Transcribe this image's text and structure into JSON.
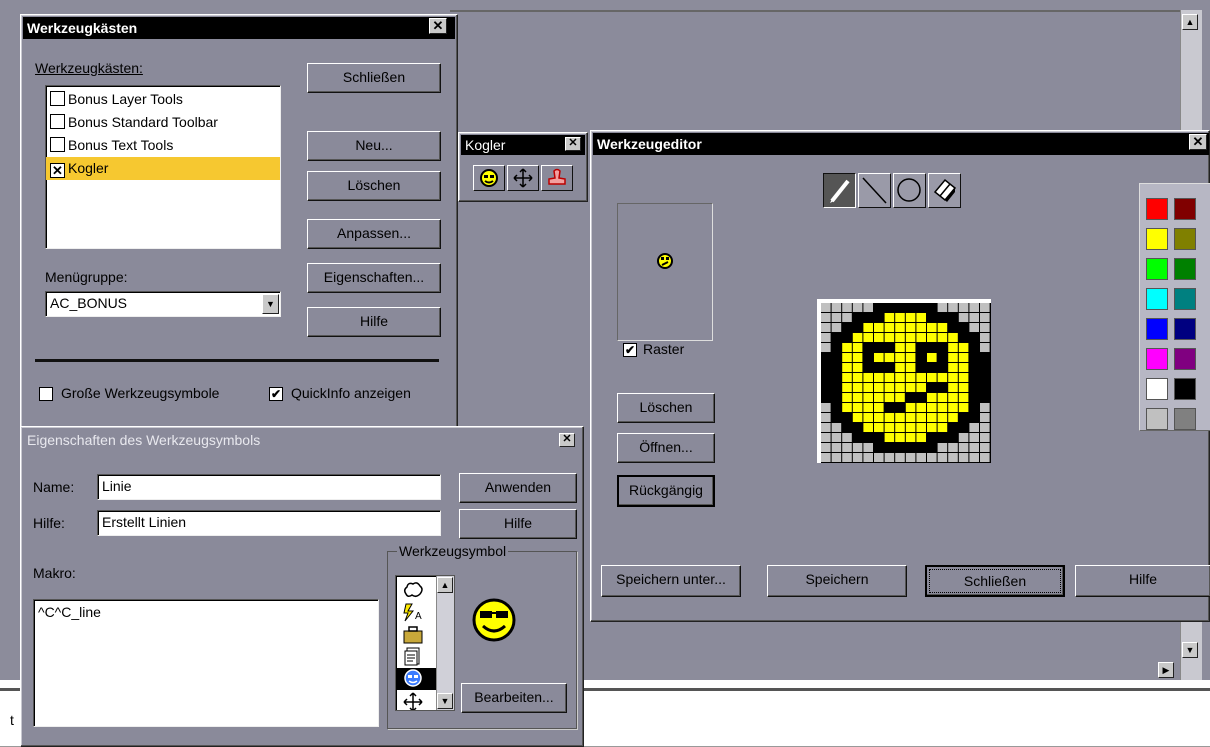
{
  "toolbars_dialog": {
    "title": "Werkzeugkästen",
    "list_label": "Werkzeugkästen:",
    "items": [
      {
        "label": "Bonus Layer Tools",
        "check": ""
      },
      {
        "label": "Bonus Standard Toolbar",
        "check": ""
      },
      {
        "label": "Bonus Text Tools",
        "check": ""
      },
      {
        "label": "Kogler",
        "check": "✕"
      }
    ],
    "buttons": {
      "close": "Schließen",
      "new": "Neu...",
      "delete": "Löschen",
      "customize": "Anpassen...",
      "properties": "Eigenschaften...",
      "help": "Hilfe"
    },
    "menu_group_label": "Menügruppe:",
    "menu_group_value": "AC_BONUS",
    "large_icons_label": "Große Werkzeugsymbole",
    "large_icons_check": "",
    "tooltips_label": "QuickInfo anzeigen",
    "tooltips_check": "✔"
  },
  "kogler_toolbar": {
    "title": "Kogler",
    "close": "✕"
  },
  "props_dialog": {
    "title": "Eigenschaften des Werkzeugsymbols",
    "name_label": "Name:",
    "name_value": "Linie",
    "help_label": "Hilfe:",
    "help_value": "Erstellt Linien",
    "macro_label": "Makro:",
    "macro_value": "^C^C_line",
    "group_label": "Werkzeugsymbol",
    "apply": "Anwenden",
    "help_button": "Hilfe",
    "edit_button": "Bearbeiten..."
  },
  "editor": {
    "title": "Werkzeugeditor",
    "raster_label": "Raster",
    "raster_check": "✔",
    "clear": "Löschen",
    "open": "Öffnen...",
    "undo": "Rückgängig",
    "save_as": "Speichern unter...",
    "save": "Speichern",
    "close": "Schließen",
    "help": "Hilfe",
    "palette": [
      "#ff0000",
      "#800000",
      "#ffff00",
      "#808000",
      "#00ff00",
      "#008000",
      "#00ffff",
      "#008080",
      "#0000ff",
      "#000080",
      "#ff00ff",
      "#800080",
      "#ffffff",
      "#000000",
      "#c0c0c0",
      "#808080"
    ]
  },
  "colors": {
    "active_title": "#000000",
    "inactive_title": "#8a8a9a",
    "selection": "#f6c830",
    "smiley": "#ffff00"
  },
  "bottom_char": "t",
  "close_glyph": "✕"
}
